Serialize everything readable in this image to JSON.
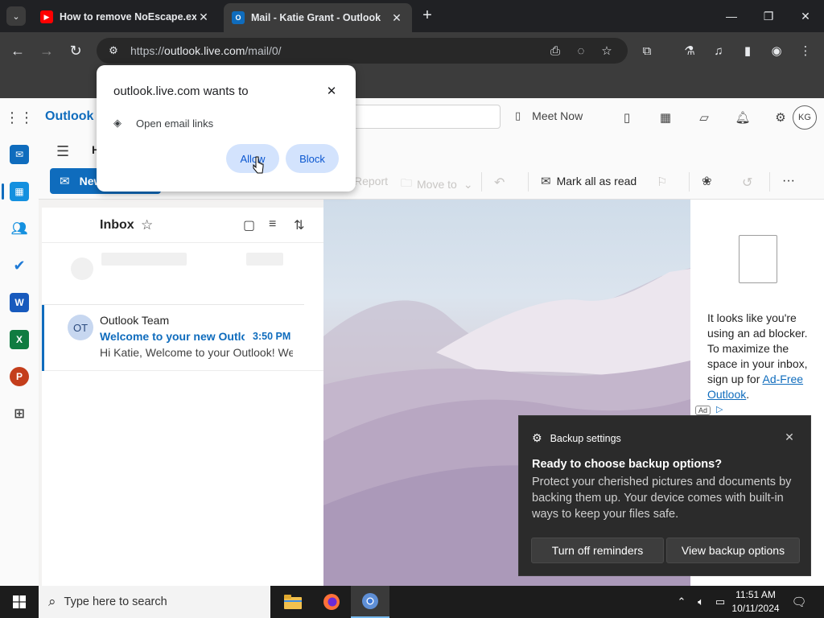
{
  "browser": {
    "tabs": [
      {
        "title": "How to remove NoEscape.exe",
        "favicon": "youtube-icon",
        "active": false
      },
      {
        "title": "Mail - Katie Grant - Outlook",
        "favicon": "outlook-icon",
        "active": true
      }
    ],
    "url_prefix": "https://",
    "url_host": "outlook.live.com",
    "url_path": "/mail/0/"
  },
  "permission_prompt": {
    "title": "outlook.live.com wants to",
    "request": "Open email links",
    "allow_label": "Allow",
    "block_label": "Block"
  },
  "outlook": {
    "brand": "Outlook",
    "meet_now": "Meet Now",
    "avatar_initials": "KG",
    "home_tab": "H",
    "ribbon": {
      "new_mail": "New mail",
      "report": "Report",
      "move_to": "Move to",
      "mark_all_read": "Mark all as read"
    },
    "inbox": {
      "title": "Inbox",
      "messages": [
        {
          "initials": "OT",
          "from": "Outlook Team",
          "subject": "Welcome to your new Outlook.com account",
          "time": "3:50 PM",
          "preview": "Hi Katie, Welcome to your Outlook! We're so glad you're here."
        }
      ]
    },
    "ad_pane": {
      "text_before_link": "It looks like you're using an ad blocker. To maximize the space in your inbox, sign up for ",
      "link": "Ad-Free Outlook",
      "text_after_link": ".",
      "badge": "Ad"
    }
  },
  "toast": {
    "app": "Backup settings",
    "title": "Ready to choose backup options?",
    "body": "Protect your cherished pictures and documents by backing them up. Your device comes with built-in ways to keep your files safe.",
    "button_left": "Turn off reminders",
    "button_right": "View backup options"
  },
  "taskbar": {
    "search_placeholder": "Type here to search",
    "time": "11:51 AM",
    "date": "10/11/2024"
  },
  "colors": {
    "accent": "#0f6cbd",
    "chrome_dark": "#202124",
    "toast_bg": "#2b2b2b"
  }
}
